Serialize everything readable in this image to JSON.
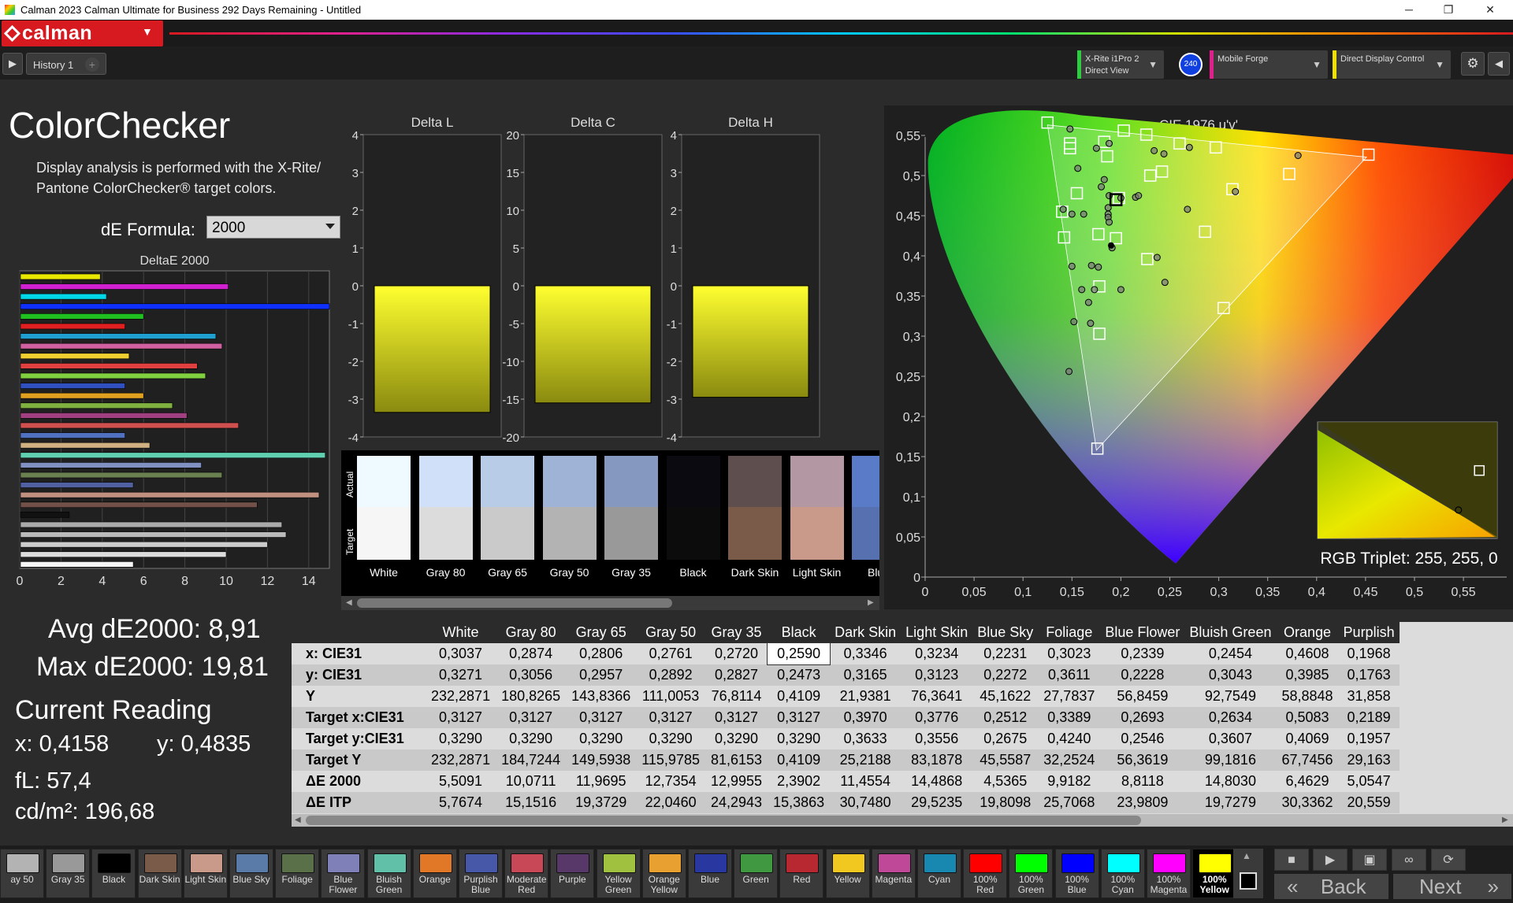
{
  "window": {
    "title": "Calman 2023 Calman Ultimate for Business 292 Days Remaining - Untitled",
    "minimize": "─",
    "maximize": "❐",
    "close": "✕"
  },
  "app": {
    "brand": "calman",
    "tab": "History 1",
    "tab_add": "+"
  },
  "devices": {
    "meter": "X-Rite i1Pro 2\nDirect View",
    "meter_badge": "240",
    "source": "Mobile Forge",
    "display": "Direct Display Control",
    "meter_color": "#2ecc40",
    "source_color": "#e0208c",
    "display_color": "#f0e000"
  },
  "page": {
    "title": "ColorChecker",
    "description": "Display analysis is performed with the X-Rite/ Pantone ColorChecker® target colors.",
    "de_formula_label": "dE Formula:",
    "de_formula_value": "2000"
  },
  "delta_charts": [
    {
      "title": "Delta L",
      "ticks": [
        "4",
        "3",
        "2",
        "1",
        "0",
        "-1",
        "-2",
        "-3",
        "-4"
      ],
      "range": [
        -4,
        4
      ],
      "value": -3.35
    },
    {
      "title": "Delta C",
      "ticks": [
        "20",
        "15",
        "10",
        "5",
        "0",
        "-5",
        "-10",
        "-15",
        "-20"
      ],
      "range": [
        -20,
        20
      ],
      "value": -15.5
    },
    {
      "title": "Delta H",
      "ticks": [
        "4",
        "3",
        "2",
        "1",
        "0",
        "-1",
        "-2",
        "-3",
        "-4"
      ],
      "range": [
        -4,
        4
      ],
      "value": -2.95
    }
  ],
  "swatch_strip": {
    "actual_label": "Actual",
    "target_label": "Target",
    "items": [
      {
        "name": "White",
        "actual": "#eefaff",
        "target": "#f6f6f6"
      },
      {
        "name": "Gray 80",
        "actual": "#cfe0f8",
        "target": "#dcdcdc"
      },
      {
        "name": "Gray 65",
        "actual": "#b8cce8",
        "target": "#cacaca"
      },
      {
        "name": "Gray 50",
        "actual": "#9eb3d6",
        "target": "#b3b3b3"
      },
      {
        "name": "Gray 35",
        "actual": "#8598c0",
        "target": "#999999"
      },
      {
        "name": "Black",
        "actual": "#0a0a10",
        "target": "#0c0c0c"
      },
      {
        "name": "Dark Skin",
        "actual": "#5e4e4e",
        "target": "#7a5a48"
      },
      {
        "name": "Light Skin",
        "actual": "#b397a2",
        "target": "#c9998a"
      },
      {
        "name": "Blue",
        "actual": "#5a7cc8",
        "target": "#5670b0"
      }
    ]
  },
  "deltae_chart": {
    "title": "DeltaE 2000",
    "xticks": [
      "0",
      "2",
      "4",
      "6",
      "8",
      "10",
      "12",
      "14"
    ],
    "xmax": 15,
    "bars": [
      {
        "value": 3.9,
        "color": "#e8e800"
      },
      {
        "value": 10.1,
        "color": "#d020d0"
      },
      {
        "value": 4.2,
        "color": "#00d8e8"
      },
      {
        "value": 15,
        "color": "#1030ff"
      },
      {
        "value": 6,
        "color": "#20c020"
      },
      {
        "value": 5.1,
        "color": "#e02020"
      },
      {
        "value": 9.5,
        "color": "#20a0d0"
      },
      {
        "value": 9.8,
        "color": "#d060a0"
      },
      {
        "value": 5.3,
        "color": "#f0d030"
      },
      {
        "value": 8.6,
        "color": "#e04040"
      },
      {
        "value": 9,
        "color": "#80d040"
      },
      {
        "value": 5.1,
        "color": "#3050c0"
      },
      {
        "value": 6,
        "color": "#e0a020"
      },
      {
        "value": 7.4,
        "color": "#80b040"
      },
      {
        "value": 8.1,
        "color": "#a04080"
      },
      {
        "value": 10.6,
        "color": "#d05050"
      },
      {
        "value": 5.1,
        "color": "#5070c0"
      },
      {
        "value": 6.3,
        "color": "#d0b080"
      },
      {
        "value": 14.8,
        "color": "#60d0b0"
      },
      {
        "value": 8.8,
        "color": "#8090c0"
      },
      {
        "value": 9.8,
        "color": "#6b8050"
      },
      {
        "value": 5.5,
        "color": "#5060a0"
      },
      {
        "value": 14.5,
        "color": "#c09080"
      },
      {
        "value": 11.5,
        "color": "#705048"
      },
      {
        "value": 2.4,
        "color": "#111111"
      },
      {
        "value": 12.7,
        "color": "#aaaaaa"
      },
      {
        "value": 12.9,
        "color": "#bbbbbb"
      },
      {
        "value": 12,
        "color": "#cccccc"
      },
      {
        "value": 10,
        "color": "#dddddd"
      },
      {
        "value": 5.5,
        "color": "#f5f5f5"
      }
    ]
  },
  "summary": {
    "avg": "Avg dE2000: 8,91",
    "max": "Max dE2000: 19,81",
    "current_reading_title": "Current Reading",
    "x": "x: 0,4158",
    "y": "y: 0,4835",
    "fl": "fL: 57,4",
    "cdm2": "cd/m²: 196,68"
  },
  "cie_chart": {
    "title": "CIE 1976 u'v'",
    "rgb_triplet": "RGB Triplet: 255, 255, 0",
    "xticks": [
      "0",
      "0,05",
      "0,1",
      "0,15",
      "0,2",
      "0,25",
      "0,3",
      "0,35",
      "0,4",
      "0,45",
      "0,5",
      "0,55"
    ],
    "yticks": [
      "0",
      "0,05",
      "0,1",
      "0,15",
      "0,2",
      "0,25",
      "0,3",
      "0,35",
      "0,4",
      "0,45",
      "0,5",
      "0,55"
    ],
    "targets": [
      [
        0.125,
        0.566
      ],
      [
        0.148,
        0.534
      ],
      [
        0.148,
        0.54
      ],
      [
        0.183,
        0.542
      ],
      [
        0.186,
        0.524
      ],
      [
        0.203,
        0.556
      ],
      [
        0.226,
        0.551
      ],
      [
        0.26,
        0.54
      ],
      [
        0.297,
        0.535
      ],
      [
        0.372,
        0.502
      ],
      [
        0.453,
        0.526
      ],
      [
        0.23,
        0.5
      ],
      [
        0.242,
        0.505
      ],
      [
        0.314,
        0.483
      ],
      [
        0.155,
        0.478
      ],
      [
        0.14,
        0.455
      ],
      [
        0.198,
        0.472
      ],
      [
        0.177,
        0.427
      ],
      [
        0.142,
        0.423
      ],
      [
        0.195,
        0.422
      ],
      [
        0.227,
        0.396
      ],
      [
        0.286,
        0.43
      ],
      [
        0.178,
        0.362
      ],
      [
        0.305,
        0.335
      ],
      [
        0.178,
        0.303
      ],
      [
        0.176,
        0.16
      ]
    ],
    "measured": [
      [
        0.148,
        0.558
      ],
      [
        0.175,
        0.534
      ],
      [
        0.188,
        0.54
      ],
      [
        0.234,
        0.531
      ],
      [
        0.244,
        0.527
      ],
      [
        0.27,
        0.535
      ],
      [
        0.381,
        0.525
      ],
      [
        0.156,
        0.509
      ],
      [
        0.183,
        0.495
      ],
      [
        0.18,
        0.486
      ],
      [
        0.188,
        0.475
      ],
      [
        0.2,
        0.472
      ],
      [
        0.215,
        0.473
      ],
      [
        0.218,
        0.475
      ],
      [
        0.268,
        0.458
      ],
      [
        0.317,
        0.48
      ],
      [
        0.141,
        0.458
      ],
      [
        0.15,
        0.452
      ],
      [
        0.162,
        0.452
      ],
      [
        0.187,
        0.46
      ],
      [
        0.187,
        0.452
      ],
      [
        0.187,
        0.448
      ],
      [
        0.188,
        0.442
      ],
      [
        0.191,
        0.41
      ],
      [
        0.15,
        0.387
      ],
      [
        0.17,
        0.388
      ],
      [
        0.177,
        0.386
      ],
      [
        0.16,
        0.358
      ],
      [
        0.173,
        0.358
      ],
      [
        0.2,
        0.358
      ],
      [
        0.237,
        0.398
      ],
      [
        0.245,
        0.367
      ],
      [
        0.167,
        0.342
      ],
      [
        0.152,
        0.318
      ],
      [
        0.169,
        0.316
      ],
      [
        0.147,
        0.256
      ]
    ],
    "current": [
      0.19,
      0.413
    ],
    "current_selected": [
      0.195,
      0.47
    ]
  },
  "inset": {
    "target": [
      0.5,
      0.49
    ],
    "measured": [
      0.49,
      0.45
    ]
  },
  "table": {
    "columns": [
      "White",
      "Gray 80",
      "Gray 65",
      "Gray 50",
      "Gray 35",
      "Black",
      "Dark Skin",
      "Light Skin",
      "Blue Sky",
      "Foliage",
      "Blue Flower",
      "Bluish Green",
      "Orange",
      "Purplish"
    ],
    "rows": [
      {
        "label": "x: CIE31",
        "values": [
          "0,3037",
          "0,2874",
          "0,2806",
          "0,2761",
          "0,2720",
          "0,2590",
          "0,3346",
          "0,3234",
          "0,2231",
          "0,3023",
          "0,2339",
          "0,2454",
          "0,4608",
          "0,1968"
        ]
      },
      {
        "label": "y: CIE31",
        "values": [
          "0,3271",
          "0,3056",
          "0,2957",
          "0,2892",
          "0,2827",
          "0,2473",
          "0,3165",
          "0,3123",
          "0,2272",
          "0,3611",
          "0,2228",
          "0,3043",
          "0,3985",
          "0,1763"
        ]
      },
      {
        "label": "Y",
        "values": [
          "232,2871",
          "180,8265",
          "143,8366",
          "111,0053",
          "76,8114",
          "0,4109",
          "21,9381",
          "76,3641",
          "45,1622",
          "27,7837",
          "56,8459",
          "92,7549",
          "58,8848",
          "31,858"
        ]
      },
      {
        "label": "Target x:CIE31",
        "values": [
          "0,3127",
          "0,3127",
          "0,3127",
          "0,3127",
          "0,3127",
          "0,3127",
          "0,3970",
          "0,3776",
          "0,2512",
          "0,3389",
          "0,2693",
          "0,2634",
          "0,5083",
          "0,2189"
        ]
      },
      {
        "label": "Target y:CIE31",
        "values": [
          "0,3290",
          "0,3290",
          "0,3290",
          "0,3290",
          "0,3290",
          "0,3290",
          "0,3633",
          "0,3556",
          "0,2675",
          "0,4240",
          "0,2546",
          "0,3607",
          "0,4069",
          "0,1957"
        ]
      },
      {
        "label": "Target Y",
        "values": [
          "232,2871",
          "184,7244",
          "149,5938",
          "115,9785",
          "81,6153",
          "0,4109",
          "25,2188",
          "83,1878",
          "45,5587",
          "32,2524",
          "56,3619",
          "99,1816",
          "67,7456",
          "29,163"
        ]
      },
      {
        "label": "ΔE 2000",
        "values": [
          "5,5091",
          "10,0711",
          "11,9695",
          "12,7354",
          "12,9955",
          "2,3902",
          "11,4554",
          "14,4868",
          "4,5365",
          "9,9182",
          "8,8118",
          "14,8030",
          "6,4629",
          "5,0547"
        ]
      },
      {
        "label": "ΔE ITP",
        "values": [
          "5,7674",
          "15,1516",
          "19,3729",
          "22,0460",
          "24,2943",
          "15,3863",
          "30,7480",
          "29,5235",
          "19,8098",
          "25,7068",
          "23,9809",
          "19,7279",
          "30,3362",
          "20,559"
        ]
      }
    ]
  },
  "bottom_swatches": [
    {
      "label": "ay 50",
      "color": "#b3b3b3"
    },
    {
      "label": "Gray 35",
      "color": "#999999"
    },
    {
      "label": "Black",
      "color": "#000000"
    },
    {
      "label": "Dark Skin",
      "color": "#7a5a48"
    },
    {
      "label": "Light Skin",
      "color": "#c9998a"
    },
    {
      "label": "Blue Sky",
      "color": "#5a7aa8"
    },
    {
      "label": "Foliage",
      "color": "#5a7048"
    },
    {
      "label": "Blue Flower",
      "color": "#8080b8"
    },
    {
      "label": "Bluish Green",
      "color": "#60c0a8"
    },
    {
      "label": "Orange",
      "color": "#e07828"
    },
    {
      "label": "Purplish Blue",
      "color": "#4858a8"
    },
    {
      "label": "Moderate Red",
      "color": "#c84858"
    },
    {
      "label": "Purple",
      "color": "#583868"
    },
    {
      "label": "Yellow Green",
      "color": "#a0c040"
    },
    {
      "label": "Orange Yellow",
      "color": "#e8a030"
    },
    {
      "label": "Blue",
      "color": "#2838a0"
    },
    {
      "label": "Green",
      "color": "#409840"
    },
    {
      "label": "Red",
      "color": "#b82830"
    },
    {
      "label": "Yellow",
      "color": "#f0c820"
    },
    {
      "label": "Magenta",
      "color": "#c04898"
    },
    {
      "label": "Cyan",
      "color": "#1888b0"
    },
    {
      "label": "100% Red",
      "color": "#ff0000"
    },
    {
      "label": "100% Green",
      "color": "#00ff00"
    },
    {
      "label": "100% Blue",
      "color": "#0000ff"
    },
    {
      "label": "100% Cyan",
      "color": "#00ffff"
    },
    {
      "label": "100% Magenta",
      "color": "#ff00ff"
    },
    {
      "label": "100% Yellow",
      "color": "#ffff00"
    }
  ],
  "nav": {
    "back": "Back",
    "next": "Next"
  }
}
